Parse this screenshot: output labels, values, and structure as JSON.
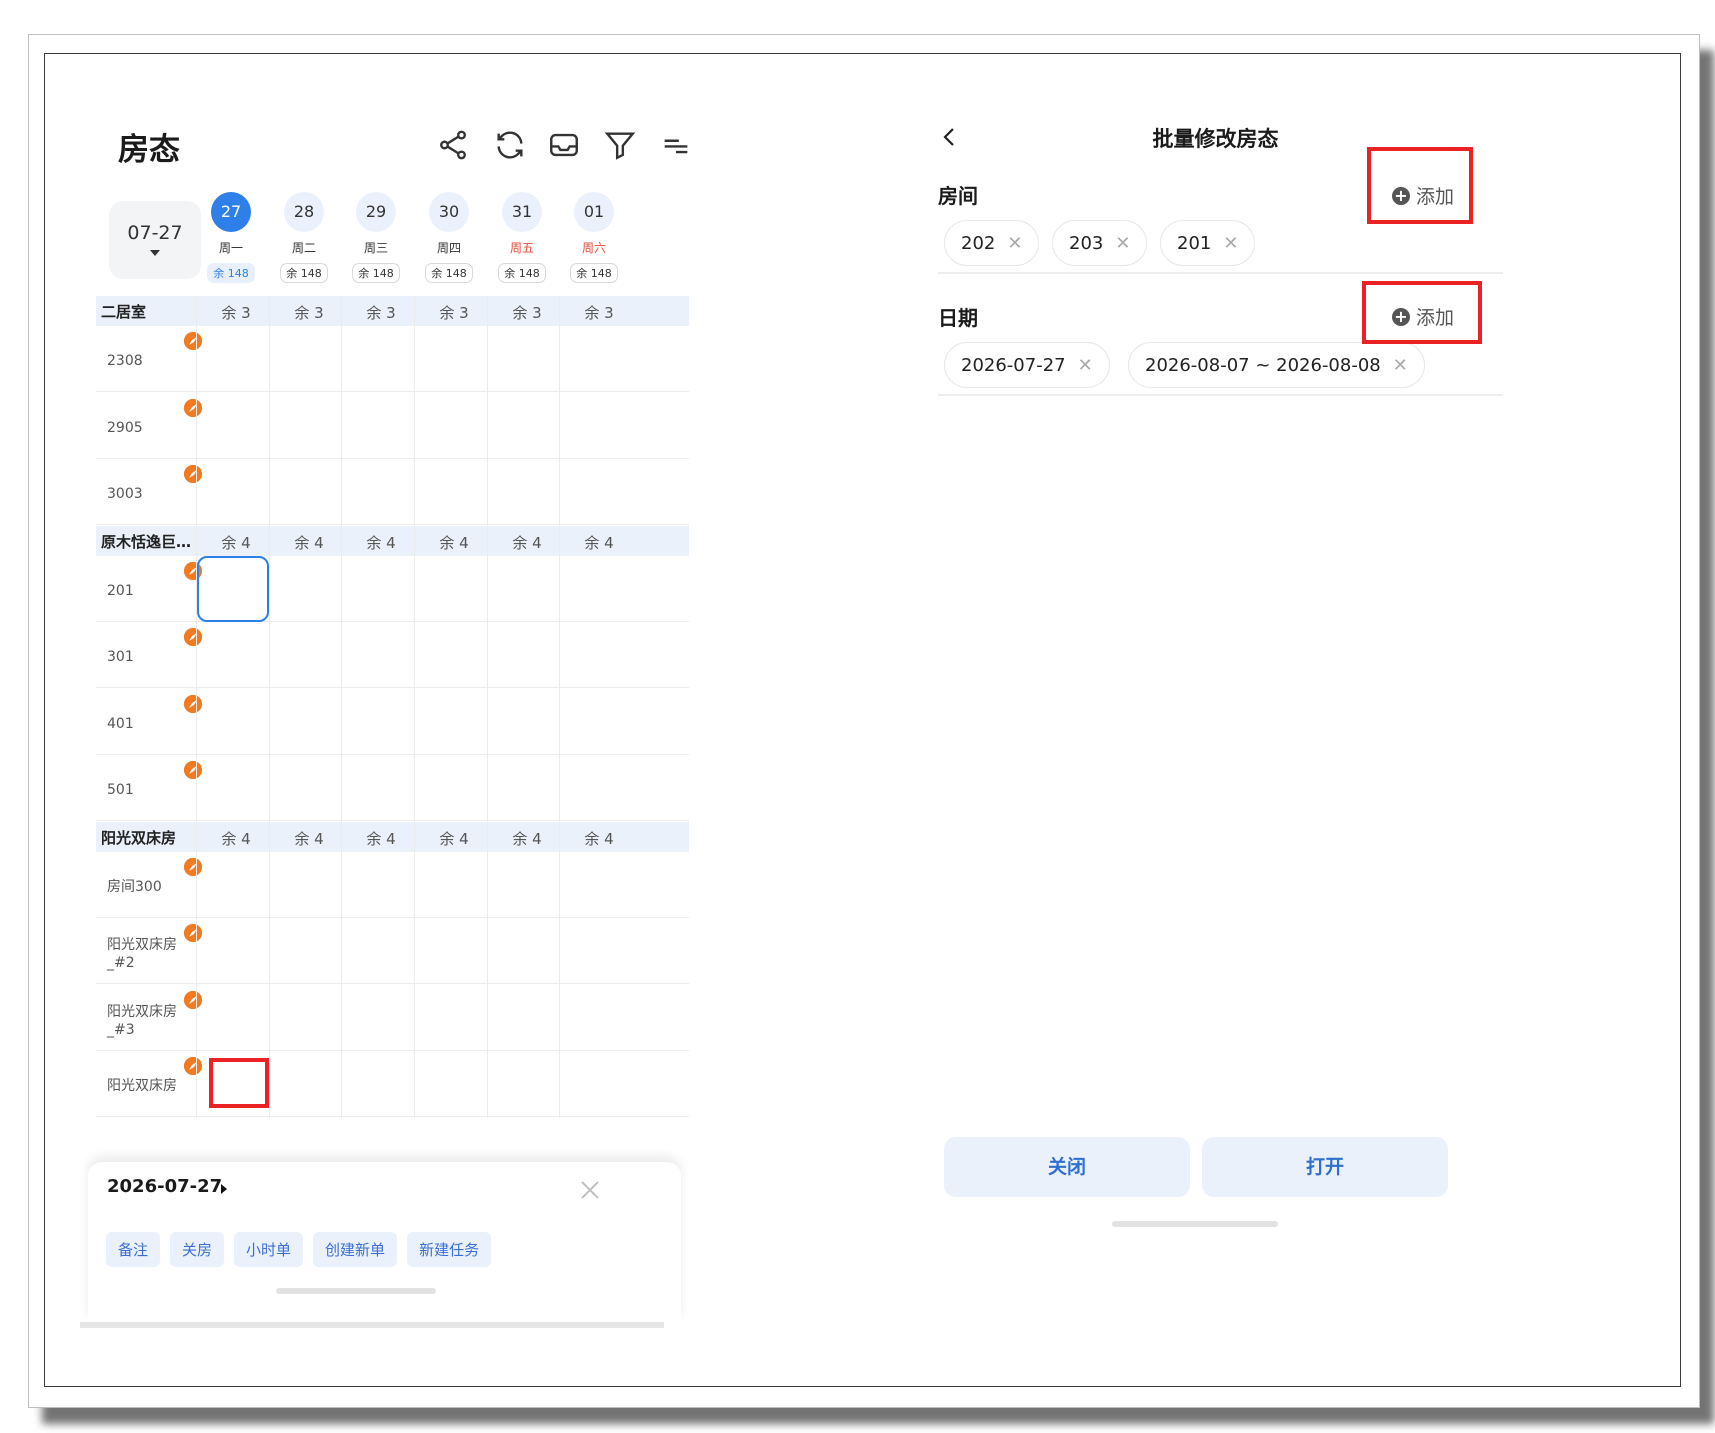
{
  "left_panel": {
    "title": "房态",
    "toolbar_icons": [
      "share-icon",
      "refresh-icon",
      "inbox-icon",
      "filter-icon",
      "menu-icon"
    ],
    "current_date": "07-27",
    "dates": [
      {
        "day": "27",
        "week": "周一",
        "remain": "余 148",
        "active": true,
        "weekend": false
      },
      {
        "day": "28",
        "week": "周二",
        "remain": "余 148",
        "active": false,
        "weekend": false
      },
      {
        "day": "29",
        "week": "周三",
        "remain": "余 148",
        "active": false,
        "weekend": false
      },
      {
        "day": "30",
        "week": "周四",
        "remain": "余 148",
        "active": false,
        "weekend": false
      },
      {
        "day": "31",
        "week": "周五",
        "remain": "余 148",
        "active": false,
        "weekend": true
      },
      {
        "day": "01",
        "week": "周六",
        "remain": "余 148",
        "active": false,
        "weekend": true
      }
    ],
    "categories": [
      {
        "name": "二居室",
        "remain": [
          "余 3",
          "余 3",
          "余 3",
          "余 3",
          "余 3",
          "余 3"
        ],
        "rooms": [
          "2308",
          "2905",
          "3003"
        ]
      },
      {
        "name": "原木恬逸巨…",
        "remain": [
          "余 4",
          "余 4",
          "余 4",
          "余 4",
          "余 4",
          "余 4"
        ],
        "rooms": [
          "201",
          "301",
          "401",
          "501"
        ]
      },
      {
        "name": "阳光双床房",
        "remain": [
          "余 4",
          "余 4",
          "余 4",
          "余 4",
          "余 4",
          "余 4"
        ],
        "rooms": [
          "房间300",
          "阳光双床房\n_#2",
          "阳光双床房\n_#3",
          "阳光双床房"
        ]
      }
    ],
    "sheet": {
      "date": "2026-07-27",
      "actions": [
        "备注",
        "关房",
        "小时单",
        "创建新单",
        "新建任务"
      ]
    }
  },
  "right_panel": {
    "title": "批量修改房态",
    "rooms_label": "房间",
    "dates_label": "日期",
    "add_label": "添加",
    "rooms": [
      "202",
      "203",
      "201"
    ],
    "dates": [
      "2026-07-27",
      "2026-08-07 ~ 2026-08-08"
    ],
    "close_button": "关闭",
    "open_button": "打开"
  },
  "colors": {
    "accent": "#2f7fe8",
    "highlight_box": "#ea2226",
    "badge": "#f37a20",
    "weekend": "#e24b3b"
  }
}
